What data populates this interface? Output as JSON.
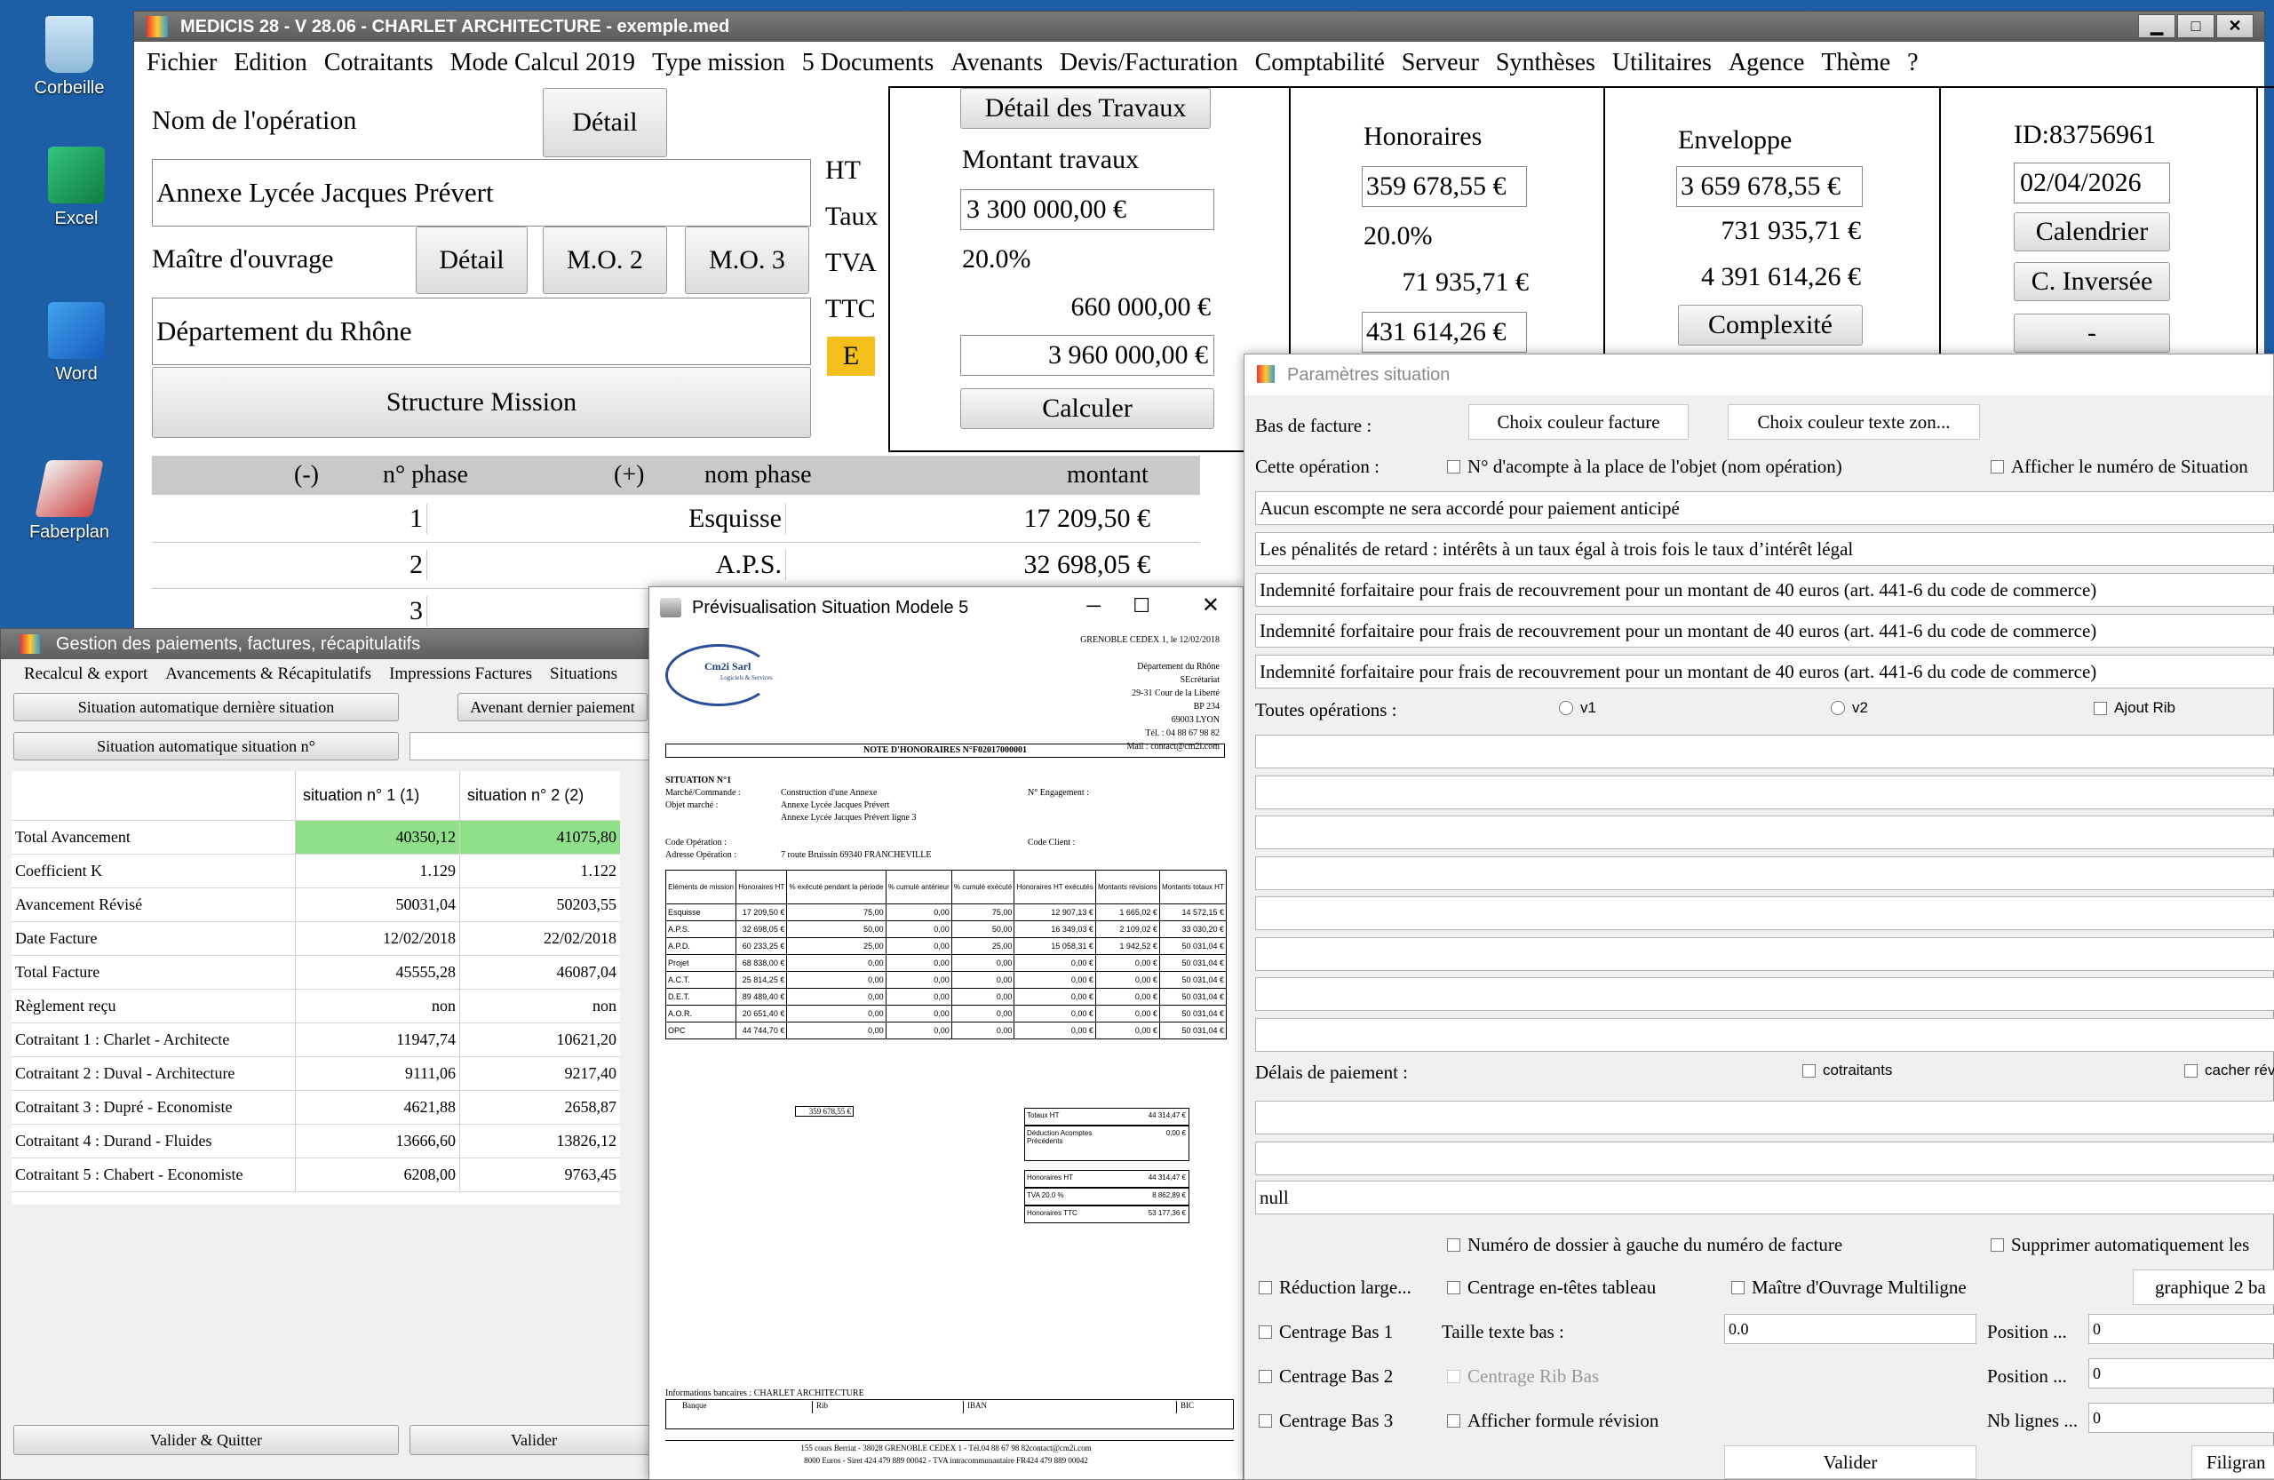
{
  "desktop": {
    "icons": [
      {
        "label": "Corbeille",
        "icon": "recycle-bin-icon"
      },
      {
        "label": "Excel",
        "icon": "excel-icon"
      },
      {
        "label": "Word",
        "icon": "word-icon"
      },
      {
        "label": "Faberplan",
        "icon": "faberplan-icon"
      }
    ]
  },
  "main": {
    "title": "MEDICIS 28  - V 28.06 - CHARLET ARCHITECTURE - exemple.med",
    "menu": [
      "Fichier",
      "Edition",
      "Cotraitants",
      "Mode Calcul 2019",
      "Type mission",
      "5 Documents",
      "Avenants",
      "Devis/Facturation",
      "Comptabilité",
      "Serveur",
      "Synthèses",
      "Utilitaires",
      "Agence",
      "Thème",
      "?"
    ],
    "operation_label": "Nom de l'opération",
    "detail_label": "Détail",
    "operation_value": "Annexe Lycée Jacques Prévert",
    "mo_label": "Maître d'ouvrage",
    "mo2_label": "M.O. 2",
    "mo3_label": "M.O. 3",
    "mo_value": "Département du Rhône",
    "structure_label": "Structure Mission",
    "ht": "HT",
    "taux": "Taux",
    "tva": "TVA",
    "ttc": "TTC",
    "e_badge": "E",
    "detail_travaux": "Détail des Travaux",
    "montant_travaux_label": "Montant travaux",
    "montant_travaux": "3 300 000,00 €",
    "taux_value": "20.0%",
    "tva_amount": "660 000,00 €",
    "ttc_amount": "3 960 000,00 €",
    "calculer": "Calculer",
    "honoraires_label": "Honoraires",
    "honoraires_ht": "359 678,55 €",
    "hon_taux": "20.0%",
    "hon_tva": "71 935,71 €",
    "hon_ttc": "431 614,26 €",
    "enveloppe_label": "Enveloppe",
    "env_ht": "3 659 678,55 €",
    "env_tva": "731 935,71 €",
    "env_ttc": "4 391 614,26 €",
    "complexite": "Complexité",
    "id": "ID:83756961",
    "date": "02/04/2026",
    "calendrier": "Calendrier",
    "c_inversee": "C. Inversée",
    "dash_btn": "-",
    "phase_headers": {
      "minus": "(-)",
      "num": "n° phase",
      "plus": "(+)",
      "name": "nom phase",
      "montant": "montant"
    },
    "phases": [
      {
        "num": "1",
        "name": "Esquisse",
        "montant": "17 209,50 €"
      },
      {
        "num": "2",
        "name": "A.P.S.",
        "montant": "32 698,05 €"
      },
      {
        "num": "3",
        "name": "",
        "montant": ""
      }
    ]
  },
  "gestion": {
    "title": "Gestion des paiements, factures, récapitulatifs",
    "menu": [
      "Recalcul & export",
      "Avancements & Récapitulatifs",
      "Impressions Factures",
      "Situations"
    ],
    "btn_auto_last": "Situation automatique dernière situation",
    "btn_avenant": "Avenant dernier paiement",
    "btn_auto_n": "Situation automatique situation n°",
    "col1": "situation n° 1 (1)",
    "col2": "situation n° 2 (2)",
    "rows": [
      {
        "label": "Total Avancement",
        "v1": "40350,12",
        "v2": "41075,80"
      },
      {
        "label": "Coefficient K",
        "v1": "1.129",
        "v2": "1.122"
      },
      {
        "label": "Avancement Révisé",
        "v1": "50031,04",
        "v2": "50203,55"
      },
      {
        "label": "Date Facture",
        "v1": "12/02/2018",
        "v2": "22/02/2018"
      },
      {
        "label": "Total Facture",
        "v1": "45555,28",
        "v2": "46087,04"
      },
      {
        "label": "Règlement reçu",
        "v1": "non",
        "v2": "non"
      },
      {
        "label": "Cotraitant 1 : Charlet - Architecte",
        "v1": "11947,74",
        "v2": "10621,20"
      },
      {
        "label": "Cotraitant 2 : Duval - Architecture",
        "v1": "9111,06",
        "v2": "9217,40"
      },
      {
        "label": "Cotraitant 3 : Dupré - Economiste",
        "v1": "4621,88",
        "v2": "2658,87"
      },
      {
        "label": "Cotraitant 4 : Durand - Fluides",
        "v1": "13666,60",
        "v2": "13826,12"
      },
      {
        "label": "Cotraitant 5 : Chabert - Economiste",
        "v1": "6208,00",
        "v2": "9763,45"
      }
    ],
    "highlight_color": "#90e08a",
    "valider_quitter": "Valider & Quitter",
    "valider": "Valider"
  },
  "preview": {
    "title": "Prévisualisation Situation Modele 5",
    "logo_text": "Cm2i Sarl",
    "logo_sub": "Logiciels & Services",
    "place_date": "GRENOBLE CEDEX 1, le 12/02/2018",
    "address": [
      "Département du Rhône",
      "SEcrétariat",
      "29-31 Cour de la Liberté",
      "BP 234",
      "69003 LYON",
      "Tél. : 04 88 67 98 82",
      "Mail : contact@cm2i.com"
    ],
    "note_title": "NOTE D'HONORAIRES N°F02017000001",
    "situation": "SITUATION N°1",
    "marche_label": "Marché/Commande :",
    "marche_value": "Construction d'une Annexe",
    "engagement_label": "N° Engagement :",
    "objet_label": "Objet marché :",
    "objet_value1": "Annexe Lycée Jacques Prévert",
    "objet_value2": "Annexe Lycée Jacques Prévert ligne 3",
    "code_op_label": "Code Opération :",
    "code_client_label": "Code Client :",
    "adresse_op_label": "Adresse Opération :",
    "adresse_op_value": "7 route Bruissin 69340 FRANCHEVILLE",
    "headers": [
      "Eléments de mission",
      "Honoraires HT",
      "% exécuté pendant la période",
      "% cumulé antérieur",
      "% cumulé exécuté",
      "Honoraires HT exécutés",
      "Montants révisions",
      "Montants totaux HT"
    ],
    "rows": [
      [
        "Esquisse",
        "17 209,50 €",
        "75,00",
        "0,00",
        "75,00",
        "12 907,13 €",
        "1 665,02 €",
        "14 572,15 €"
      ],
      [
        "A.P.S.",
        "32 698,05 €",
        "50,00",
        "0,00",
        "50,00",
        "16 349,03 €",
        "2 109,02 €",
        "33 030,20 €"
      ],
      [
        "A.P.D.",
        "60 233,25 €",
        "25,00",
        "0,00",
        "25,00",
        "15 058,31 €",
        "1 942,52 €",
        "50 031,04 €"
      ],
      [
        "Projet",
        "68 838,00 €",
        "0,00",
        "0,00",
        "0,00",
        "0,00 €",
        "0,00 €",
        "50 031,04 €"
      ],
      [
        "A.C.T.",
        "25 814,25 €",
        "0,00",
        "0,00",
        "0,00",
        "0,00 €",
        "0,00 €",
        "50 031,04 €"
      ],
      [
        "D.E.T.",
        "89 489,40 €",
        "0,00",
        "0,00",
        "0,00",
        "0,00 €",
        "0,00 €",
        "50 031,04 €"
      ],
      [
        "A.O.R.",
        "20 651,40 €",
        "0,00",
        "0,00",
        "0,00",
        "0,00 €",
        "0,00 €",
        "50 031,04 €"
      ],
      [
        "OPC",
        "44 744,70 €",
        "0,00",
        "0,00",
        "0,00",
        "0,00 €",
        "0,00 €",
        "50 031,04 €"
      ]
    ],
    "total_hon": "359 678,55 €",
    "totals": [
      [
        "Totaux HT",
        "44 314,47 €"
      ],
      [
        "Déduction Acomptes Précédents",
        "0,00 €"
      ],
      [
        "Honoraires HT",
        "44 314,47 €"
      ],
      [
        "TVA 20.0 %",
        "8 862,89 €"
      ],
      [
        "Honoraires TTC",
        "53 177,36 €"
      ]
    ],
    "bank_label": "Informations bancaires : CHARLET ARCHITECTURE",
    "bank_headers": [
      "Banque",
      "Rib",
      "IBAN",
      "BIC"
    ],
    "footer1": "155 cours Berriat - 38028 GRENOBLE CEDEX 1 - Tél.04 88 67 98 82contact@cm2i.com",
    "footer2": "8000 Euros - Siret 424 479 889 00042 - TVA intracommunautaire FR424 479 889 00042"
  },
  "params": {
    "title": "Paramètres situation",
    "bas_facture": "Bas de facture :",
    "btn_couleur_facture": "Choix couleur facture",
    "btn_couleur_texte": "Choix couleur texte zon...",
    "cette_operation": "Cette opération :",
    "cb_acompte": "N° d'acompte à la place de l'objet (nom opération)",
    "cb_afficher_num": "Afficher le numéro de Situation",
    "fields": [
      "Aucun escompte ne sera accordé pour paiement anticipé",
      "Les pénalités de retard : intérêts à un taux égal à trois fois le taux d’intérêt légal",
      "Indemnité forfaitaire pour frais de recouvrement pour un montant de 40 euros (art. 441-6 du code de commerce)",
      "Indemnité forfaitaire pour frais de recouvrement pour un montant de 40 euros (art. 441-6 du code de commerce)",
      "Indemnité forfaitaire pour frais de recouvrement pour un montant de 40 euros (art. 441-6 du code de commerce)"
    ],
    "toutes_operations": "Toutes opérations :",
    "v1": "v1",
    "v2": "v2",
    "ajout_rib": "Ajout Rib",
    "delais": "Délais de paiement :",
    "cotraitants": "cotraitants",
    "cacher": "cacher rév",
    "null_value": "null",
    "cb_numero_dossier": "Numéro de dossier à gauche du numéro de facture",
    "cb_supprimer": "Supprimer automatiquement les",
    "cb_reduction": "Réduction large...",
    "cb_centrage_entetes": "Centrage en-têtes tableau",
    "cb_mo_multiligne": "Maître d'Ouvrage Multiligne",
    "btn_graphique": "graphique 2 ba",
    "cb_centrage_bas1": "Centrage Bas 1",
    "taille_texte": "Taille texte bas :",
    "taille_value": "0.0",
    "position_label": "Position ...",
    "position1": "0",
    "cb_centrage_bas2": "Centrage Bas 2",
    "cb_centrage_rib": "Centrage Rib Bas",
    "position2": "0",
    "cb_centrage_bas3": "Centrage Bas 3",
    "cb_afficher_formule": "Afficher formule révision",
    "nb_lignes": "Nb lignes ...",
    "nb_value": "0",
    "valider": "Valider",
    "filigrane": "Filigran"
  }
}
